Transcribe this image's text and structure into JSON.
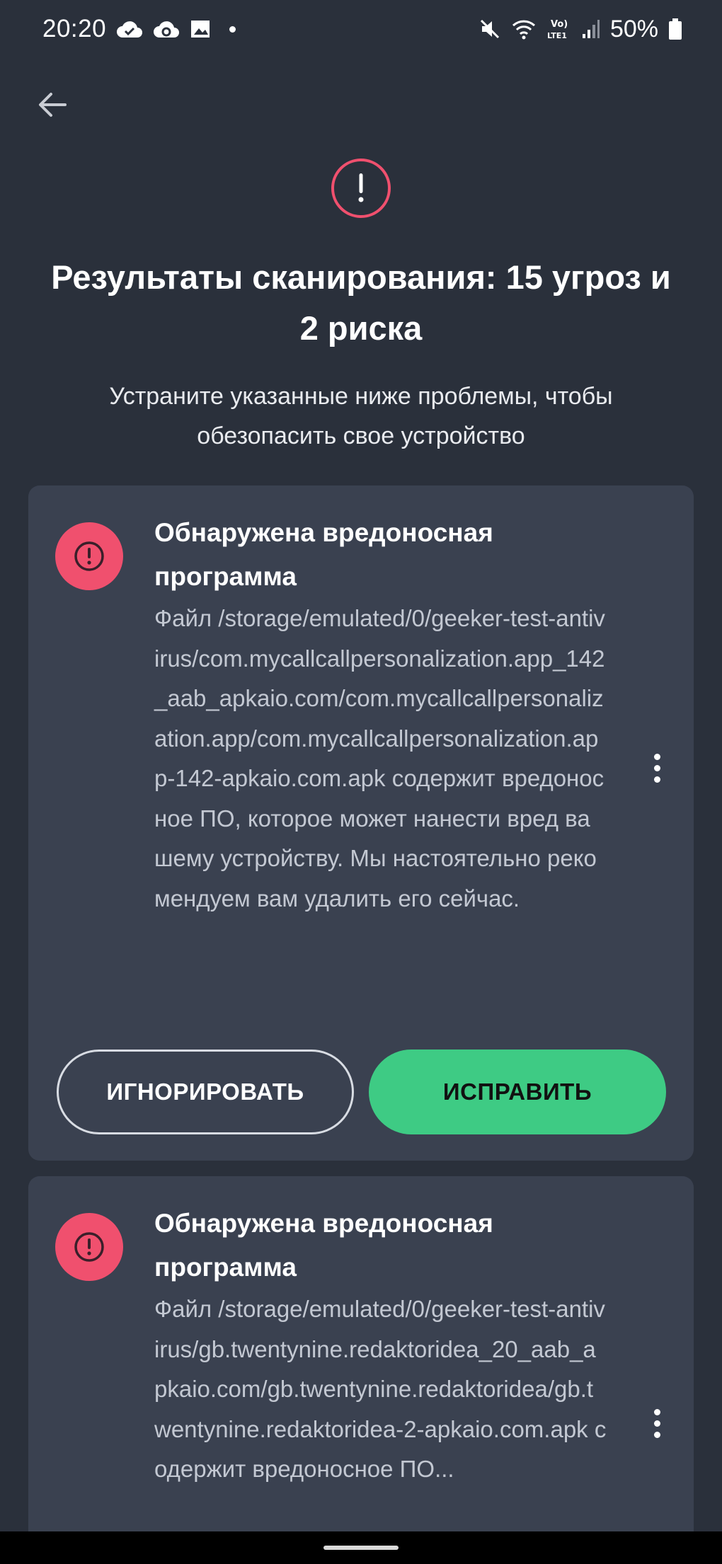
{
  "status_bar": {
    "time": "20:20",
    "battery": "50%",
    "icons": [
      "cloud-check-icon",
      "cloud-sync-icon",
      "gallery-icon",
      "mute-icon",
      "wifi-icon",
      "volte-icon",
      "signal-icon",
      "battery-icon"
    ]
  },
  "header": {
    "back_icon": "arrow-left-icon",
    "alert_icon": "exclamation-circle-icon",
    "title": "Результаты сканирования: 15 угроз и 2 риска",
    "subtitle": "Устраните указанные ниже проблемы, чтобы обезопасить свое устройство"
  },
  "threats": [
    {
      "title": "Обнаружена вредоносная программа",
      "description": "Файл /storage/emulated/0/geeker-test-antivirus/com.mycallcallpersonalization.app_142_aab_apkaio.com/com.mycallcallpersonalization.app/com.mycallcallpersonalization.app-142-apkaio.com.apk содержит вредоносное ПО, которое может нанести вред вашему устройству. Мы настоятельно рекомендуем вам удалить его сейчас.",
      "ignore_label": "ИГНОРИРОВАТЬ",
      "fix_label": "ИСПРАВИТЬ"
    },
    {
      "title": "Обнаружена вредоносная программа",
      "description": "Файл /storage/emulated/0/geeker-test-antivirus/gb.twentynine.redaktoridea_20_aab_apkaio.com/gb.twentynine.redaktoridea/gb.twentynine.redaktoridea-2-apkaio.com.apk содержит вредоносное ПО..."
    }
  ],
  "colors": {
    "background": "#2a303b",
    "card": "#3a4150",
    "danger": "#f0506e",
    "accent": "#3ecb84"
  }
}
